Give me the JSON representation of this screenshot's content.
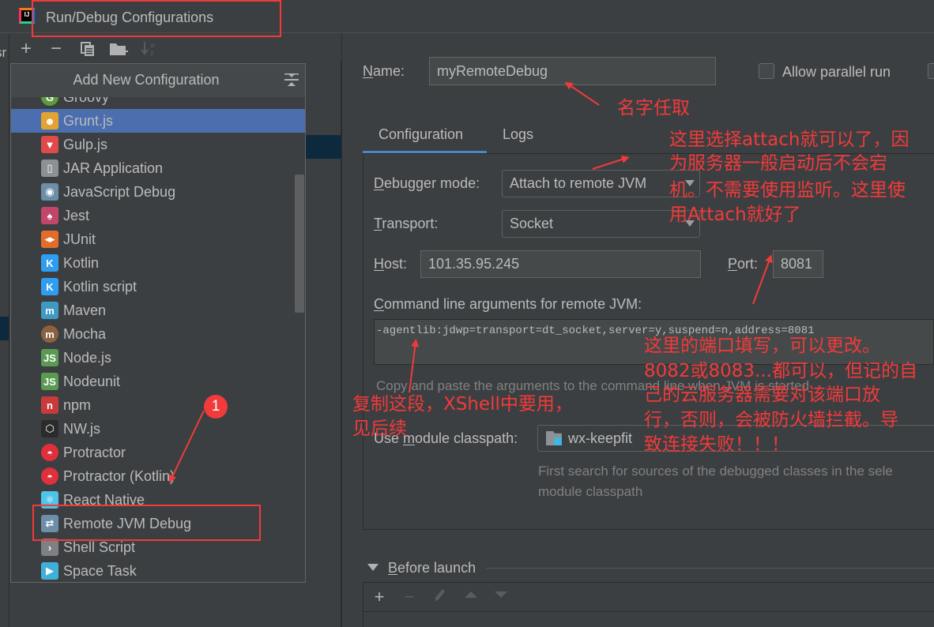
{
  "window": {
    "title": "Run/Debug Configurations"
  },
  "left_strip": {
    "fragment": "sr"
  },
  "toolbar": {
    "add": "+",
    "remove": "−",
    "copy": "copy-icon",
    "new_folder": "folder-add-icon",
    "sort": "sort-alpha-icon"
  },
  "popup": {
    "title": "Add New Configuration",
    "items": [
      {
        "label": "Groovy",
        "icon": "groovy-icon",
        "color": "#5e9b3c",
        "glyph": "G"
      },
      {
        "label": "Grunt.js",
        "icon": "grunt-icon",
        "color": "#e2a333",
        "glyph": "☻",
        "selected": true
      },
      {
        "label": "Gulp.js",
        "icon": "gulp-icon",
        "color": "#e04a4a",
        "glyph": "▼"
      },
      {
        "label": "JAR Application",
        "icon": "jar-icon",
        "color": "#8d9195",
        "glyph": "▯"
      },
      {
        "label": "JavaScript Debug",
        "icon": "javascript-debug-icon",
        "color": "#6c8ea8",
        "glyph": "◉"
      },
      {
        "label": "Jest",
        "icon": "jest-icon",
        "color": "#c2466a",
        "glyph": "♠"
      },
      {
        "label": "JUnit",
        "icon": "junit-icon",
        "color": "#e46c2b",
        "glyph": "◂▸"
      },
      {
        "label": "Kotlin",
        "icon": "kotlin-icon",
        "color": "#2f9ef0",
        "glyph": "K"
      },
      {
        "label": "Kotlin script",
        "icon": "kotlin-script-icon",
        "color": "#2f9ef0",
        "glyph": "K"
      },
      {
        "label": "Maven",
        "icon": "maven-icon",
        "color": "#3e9ac5",
        "glyph": "m"
      },
      {
        "label": "Mocha",
        "icon": "mocha-icon",
        "color": "#8b6140",
        "glyph": "m"
      },
      {
        "label": "Node.js",
        "icon": "nodejs-icon",
        "color": "#5b9a52",
        "glyph": "JS"
      },
      {
        "label": "Nodeunit",
        "icon": "nodeunit-icon",
        "color": "#5b9a52",
        "glyph": "JS"
      },
      {
        "label": "npm",
        "icon": "npm-icon",
        "color": "#c93a3a",
        "glyph": "n"
      },
      {
        "label": "NW.js",
        "icon": "nwjs-icon",
        "color": "#2b2b2b",
        "glyph": "⬡"
      },
      {
        "label": "Protractor",
        "icon": "protractor-icon",
        "color": "#e0303b",
        "glyph": "◓"
      },
      {
        "label": "Protractor (Kotlin)",
        "icon": "protractor-kotlin-icon",
        "color": "#e0303b",
        "glyph": "◓"
      },
      {
        "label": "React Native",
        "icon": "react-native-icon",
        "color": "#4fc3e8",
        "glyph": "⚛"
      },
      {
        "label": "Remote JVM Debug",
        "icon": "remote-debug-icon",
        "color": "#6c8ea8",
        "glyph": "⇄"
      },
      {
        "label": "Shell Script",
        "icon": "shell-script-icon",
        "color": "#7e8083",
        "glyph": "›"
      },
      {
        "label": "Space Task",
        "icon": "space-task-icon",
        "color": "#3fb1d9",
        "glyph": "▶"
      }
    ]
  },
  "form": {
    "name_label": "Name:",
    "name_value": "myRemoteDebug",
    "allow_parallel_label": "Allow parallel run",
    "allow_parallel_checked": false,
    "tabs": [
      {
        "label": "Configuration",
        "active": true
      },
      {
        "label": "Logs",
        "active": false
      }
    ],
    "debugger_mode_label": "Debugger mode:",
    "debugger_mode_value": "Attach to remote JVM",
    "transport_label": "Transport:",
    "transport_value": "Socket",
    "host_label": "Host:",
    "host_value": "101.35.95.245",
    "port_label": "Port:",
    "port_value": "8081",
    "cmd_label": "Command line arguments for remote JVM:",
    "cmd_value": "-agentlib:jdwp=transport=dt_socket,server=y,suspend=n,address=8081",
    "cmd_hint": "Copy and paste the arguments to the command line when JVM is started",
    "module_label": "Use module classpath:",
    "module_value": "wx-keepfit",
    "module_hint_1": "First search for sources of the debugged classes in the sele",
    "module_hint_2": "module classpath",
    "before_launch_label": "Before launch"
  },
  "annotations": {
    "name_note": "名字任取",
    "attach_note_1": "这里选择attach就可以了，因",
    "attach_note_2": "为服务器一般启动后不会宕",
    "attach_note_3": "机。不需要使用监听。这里使",
    "attach_note_4": "用Attach就好了",
    "port_note_1": "这里的端口填写，可以更改。",
    "port_note_2": "8082或8083...都可以，但记的自",
    "port_note_3": "己的云服务器需要对该端口放",
    "port_note_4": "行，否则，会被防火墙拦截。导",
    "port_note_5": "致连接失败！！！",
    "copy_note_1": "复制这段，XShell中要用，",
    "copy_note_2": "见后续",
    "badge": "1",
    "annotation_color": "#f23a3a"
  }
}
